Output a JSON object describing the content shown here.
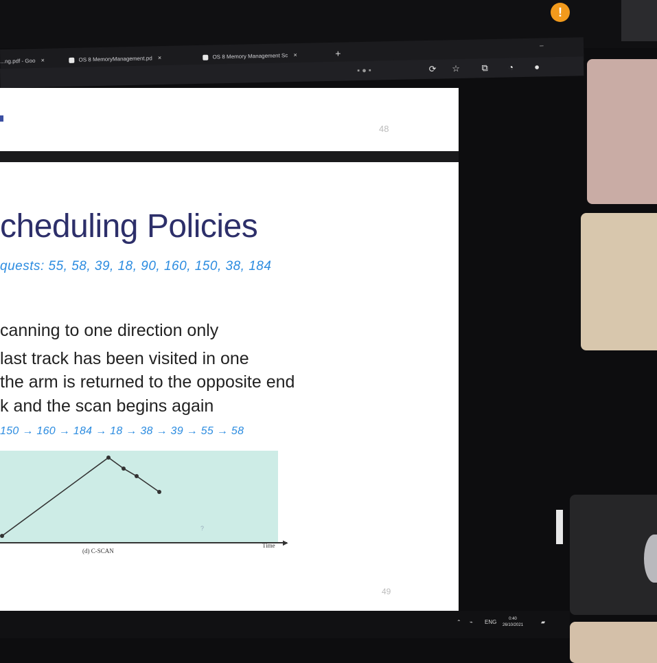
{
  "browser": {
    "tabs": [
      {
        "label": "...ng.pdf - Goo",
        "close": "×"
      },
      {
        "label": "OS 8 MemoryManagement.pd",
        "close": "×"
      },
      {
        "label": "OS 8 Memory Management Sc",
        "close": "×"
      }
    ],
    "new_tab": "+",
    "minimize": "–",
    "alert": "!"
  },
  "toolbar": {
    "buttons": [
      "refresh",
      "star",
      "extensions",
      "history",
      "profile"
    ]
  },
  "pdf": {
    "page_top_number": "48",
    "slide": {
      "title": "cheduling Policies",
      "requests_handwritten": "quests: 55, 58, 39, 18, 90, 160, 150, 38, 184",
      "bullets": [
        "canning to one direction only",
        "last track has been visited in one",
        "the arm is returned to the opposite end",
        "k and the scan begins again"
      ],
      "sequence_handwritten": "150 → 160 → 184 → 18 → 38 → 39 → 55 → 58",
      "chart_caption": "(d) C-SCAN",
      "chart_time_label": "Time",
      "page_number": "49"
    }
  },
  "taskbar": {
    "language": "ENG",
    "time": "0:40",
    "date": "26/10/2021"
  },
  "colors": {
    "title": "#2d2f6a",
    "handwriting": "#2c8ce0",
    "chart_bg": "#cdece6",
    "alert": "#f29a1c"
  }
}
